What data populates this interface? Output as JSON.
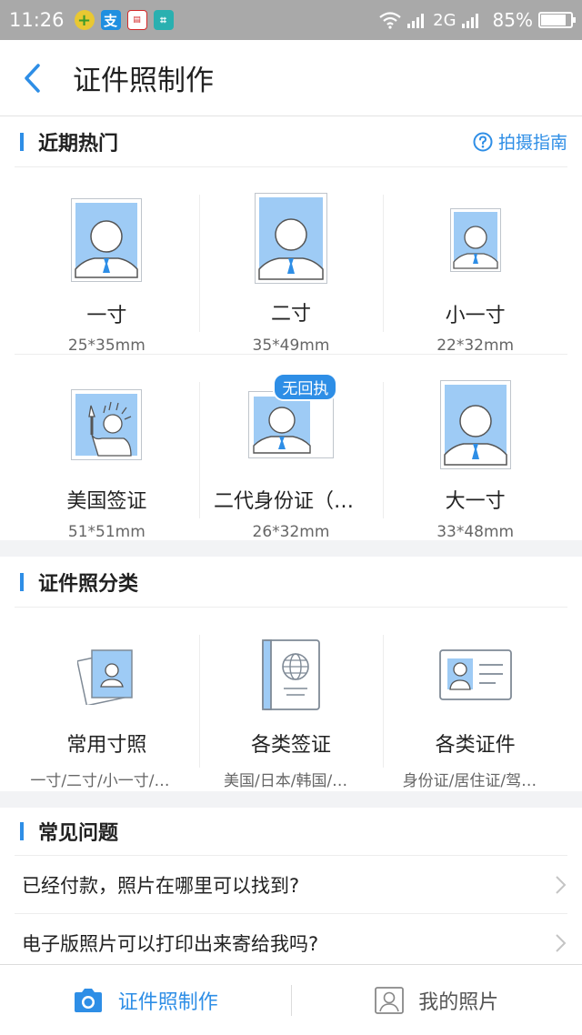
{
  "status_bar": {
    "time": "11:26",
    "network": "2G",
    "battery": "85%",
    "battery_level": 0.85,
    "app_icons": [
      "plus-circle-icon",
      "alipay-icon",
      "toutiao-icon",
      "scan-icon"
    ]
  },
  "header": {
    "title": "证件照制作"
  },
  "hot": {
    "title": "近期热门",
    "guide_label": "拍摄指南",
    "items": [
      {
        "label": "一寸",
        "size": "25*35mm"
      },
      {
        "label": "二寸",
        "size": "35*49mm"
      },
      {
        "label": "小一寸",
        "size": "22*32mm"
      },
      {
        "label": "美国签证",
        "size": "51*51mm"
      },
      {
        "label": "二代身份证（无回执）",
        "size": "26*32mm",
        "badge": "无回执"
      },
      {
        "label": "大一寸",
        "size": "33*48mm"
      }
    ]
  },
  "categories": {
    "title": "证件照分类",
    "items": [
      {
        "label": "常用寸照",
        "desc": "一寸/二寸/小一寸/大一寸"
      },
      {
        "label": "各类签证",
        "desc": "美国/日本/韩国/泰国"
      },
      {
        "label": "各类证件",
        "desc": "身份证/居住证/驾驶证"
      }
    ]
  },
  "faq": {
    "title": "常见问题",
    "items": [
      {
        "text": "已经付款，照片在哪里可以找到?"
      },
      {
        "text": "电子版照片可以打印出来寄给我吗?"
      }
    ]
  },
  "bottom_tabs": [
    {
      "label": "证件照制作",
      "active": true,
      "icon": "camera-icon"
    },
    {
      "label": "我的照片",
      "active": false,
      "icon": "photo-frame-icon"
    }
  ],
  "colors": {
    "accent": "#2e8ee6",
    "photo_bg": "#9ecbf5",
    "status_bar": "#a9a9a9"
  }
}
